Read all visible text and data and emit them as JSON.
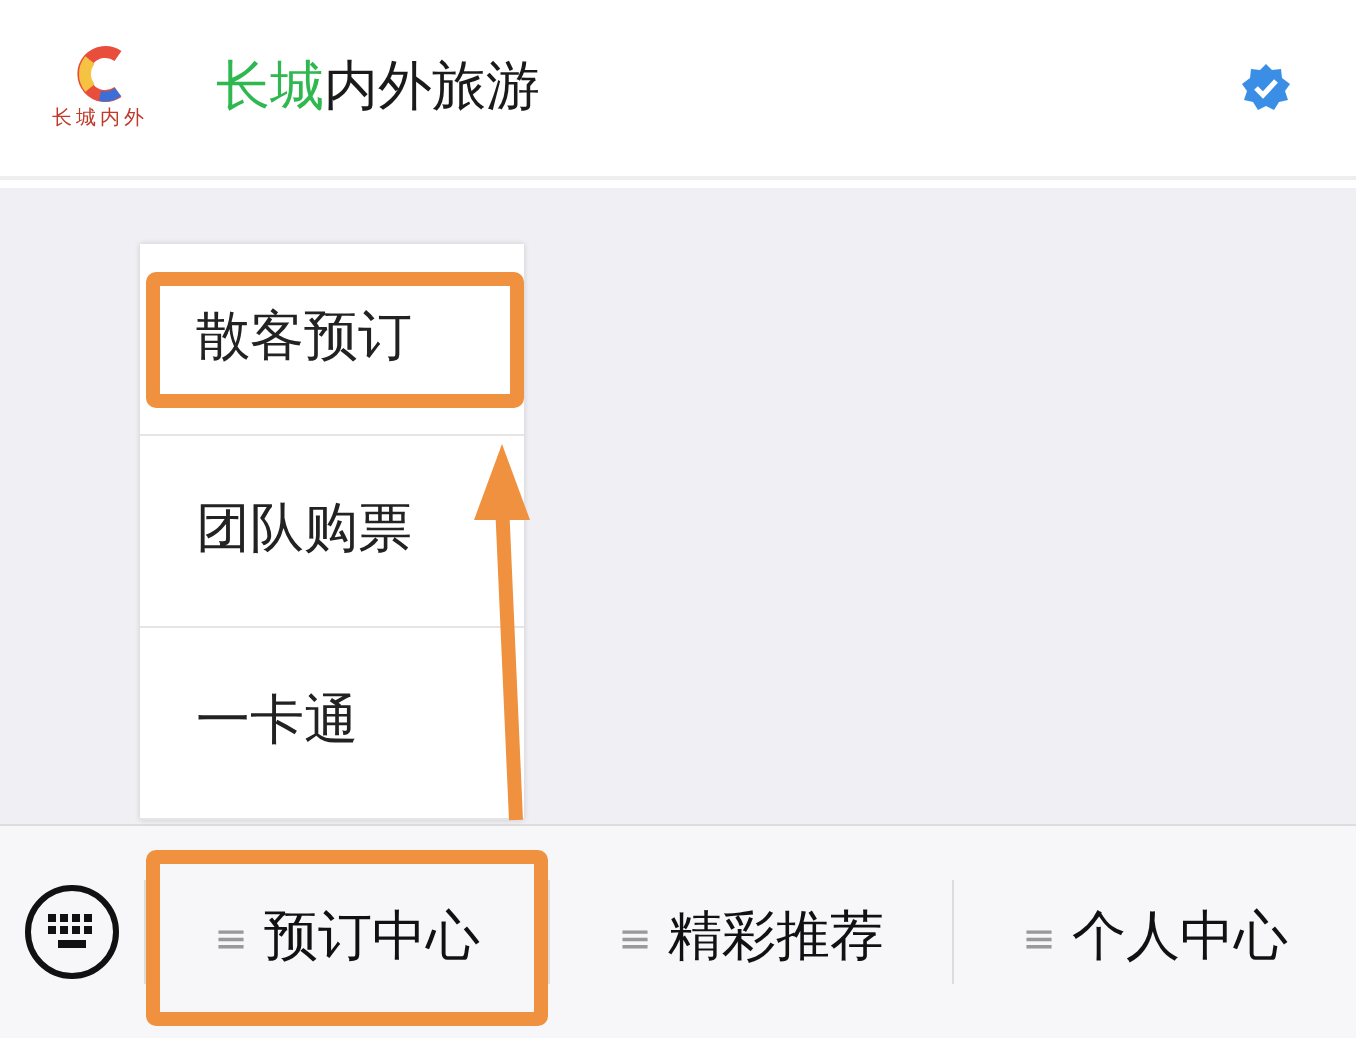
{
  "header": {
    "logo_text": "长城内外",
    "title": [
      {
        "text": "长城",
        "color": "#2fb84f"
      },
      {
        "text": "内外旅游",
        "color": "#1a1a1a"
      }
    ],
    "verified": true
  },
  "popup_menu": {
    "items": [
      {
        "label": "散客预订",
        "highlighted": true
      },
      {
        "label": "团队购票",
        "highlighted": false
      },
      {
        "label": "一卡通",
        "highlighted": false
      }
    ]
  },
  "annotation_arrow": true,
  "bottom_menu": {
    "tabs": [
      {
        "icon": "≡",
        "label": "预订中心",
        "highlighted": true
      },
      {
        "icon": "≡",
        "label": "精彩推荐",
        "highlighted": false
      },
      {
        "icon": "≡",
        "label": "个人中心",
        "highlighted": false
      }
    ]
  }
}
